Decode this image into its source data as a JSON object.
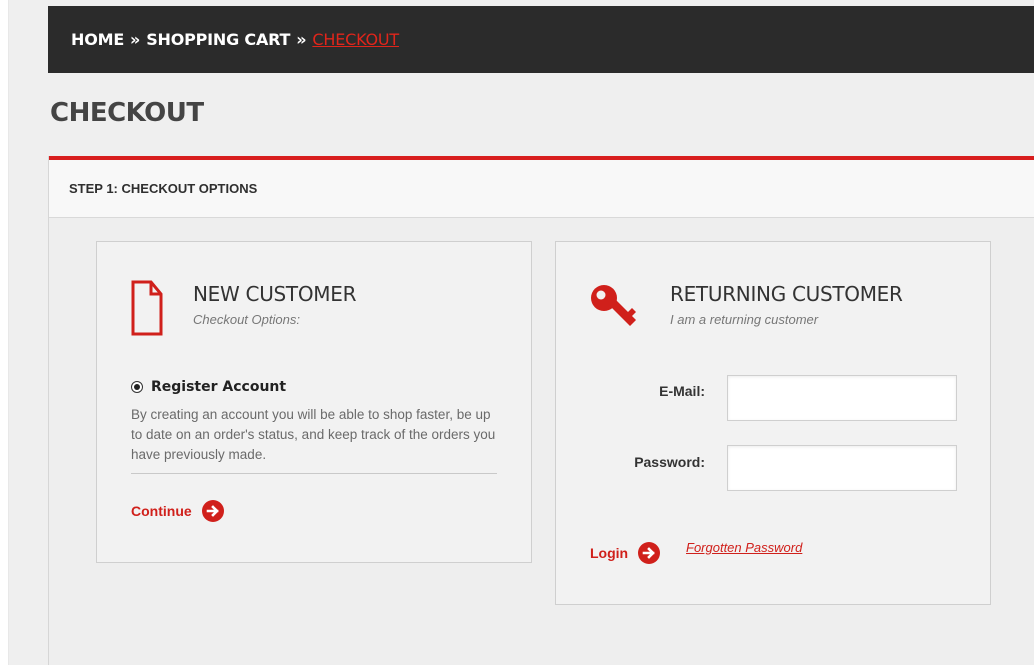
{
  "breadcrumb": {
    "items": [
      "HOME",
      "SHOPPING CART"
    ],
    "separator": "»",
    "current": "CHECKOUT"
  },
  "page": {
    "title": "CHECKOUT"
  },
  "step": {
    "heading": "STEP 1: CHECKOUT OPTIONS"
  },
  "new_customer": {
    "title": "NEW CUSTOMER",
    "subtitle": "Checkout Options:",
    "icon": "document-icon",
    "option_label": "Register Account",
    "option_selected": true,
    "description": "By creating an account you will be able to shop faster, be up to date on an order's status, and keep track of the orders you have previously made.",
    "continue_label": "Continue"
  },
  "returning_customer": {
    "title": "RETURNING CUSTOMER",
    "subtitle": "I am a returning customer",
    "icon": "key-icon",
    "email_label": "E-Mail:",
    "email_value": "",
    "password_label": "Password:",
    "password_value": "",
    "login_label": "Login",
    "forgot_label": "Forgotten Password"
  },
  "colors": {
    "accent": "#d0201b",
    "breadcrumb_bg": "#2b2b2b",
    "page_bg": "#efefef"
  }
}
